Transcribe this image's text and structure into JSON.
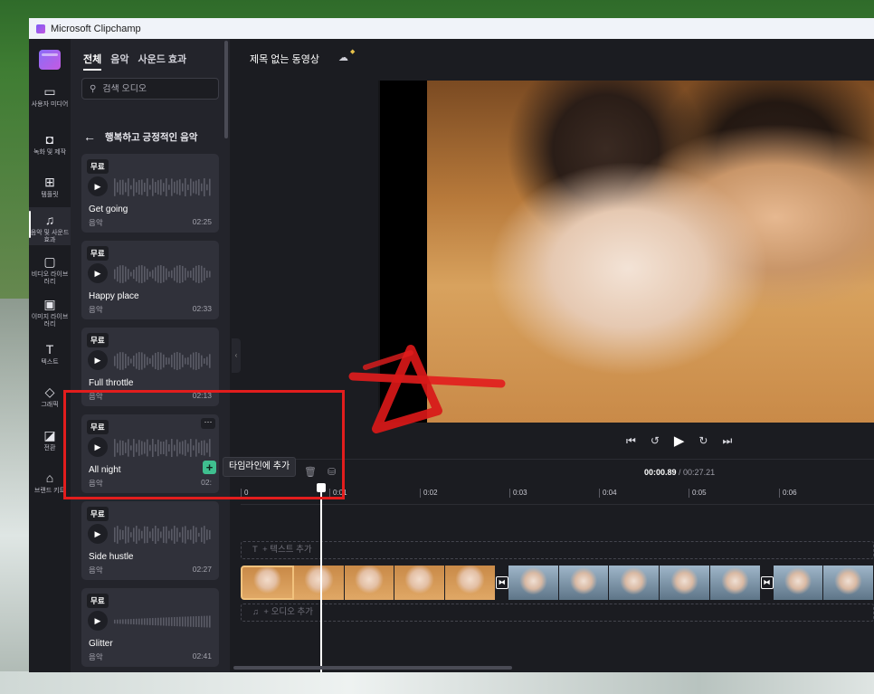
{
  "window": {
    "title": "Microsoft Clipchamp"
  },
  "rail": [
    {
      "icon": "folder-icon",
      "label": "사용자 미디어"
    },
    {
      "icon": "camera-icon",
      "label": "녹화 및 제작"
    },
    {
      "icon": "templates-icon",
      "label": "템플릿"
    },
    {
      "icon": "music-icon",
      "label": "음악 및 사운드 효과"
    },
    {
      "icon": "video-library-icon",
      "label": "비디오 라이브러리"
    },
    {
      "icon": "image-library-icon",
      "label": "이미지 라이브러리"
    },
    {
      "icon": "text-icon",
      "label": "텍스트"
    },
    {
      "icon": "graphics-icon",
      "label": "그래픽"
    },
    {
      "icon": "transitions-icon",
      "label": "전환"
    },
    {
      "icon": "brand-kit-icon",
      "label": "브랜드 키트"
    }
  ],
  "panel": {
    "tabs": [
      "전체",
      "음악",
      "사운드 효과"
    ],
    "search_placeholder": "검색 오디오",
    "breadcrumb": "행복하고 긍정적인 음악",
    "cards": [
      {
        "badge": "무료",
        "title": "Get going",
        "type": "음악",
        "duration": "02:25"
      },
      {
        "badge": "무료",
        "title": "Happy place",
        "type": "음악",
        "duration": "02:33"
      },
      {
        "badge": "무료",
        "title": "Full throttle",
        "type": "음악",
        "duration": "02:13"
      },
      {
        "badge": "무료",
        "title": "All night",
        "type": "음악",
        "duration": "02:"
      },
      {
        "badge": "무료",
        "title": "Side hustle",
        "type": "음악",
        "duration": "02:27"
      },
      {
        "badge": "무료",
        "title": "Glitter",
        "type": "음악",
        "duration": "02:41"
      }
    ],
    "add_tooltip": "타임라인에 추가"
  },
  "topbar": {
    "project_title": "제목 없는 동영상"
  },
  "timeline": {
    "current_time": "00:00.89",
    "total_time": "/ 00:27.21",
    "ticks": [
      "0",
      "0:01",
      "0:02",
      "0:03",
      "0:04",
      "0:05",
      "0:06"
    ],
    "text_track": "+ 텍스트 추가",
    "audio_track": "+ 오디오 추가"
  },
  "colors": {
    "accent": "#3fbf8f",
    "highlight": "#e21d1d"
  }
}
